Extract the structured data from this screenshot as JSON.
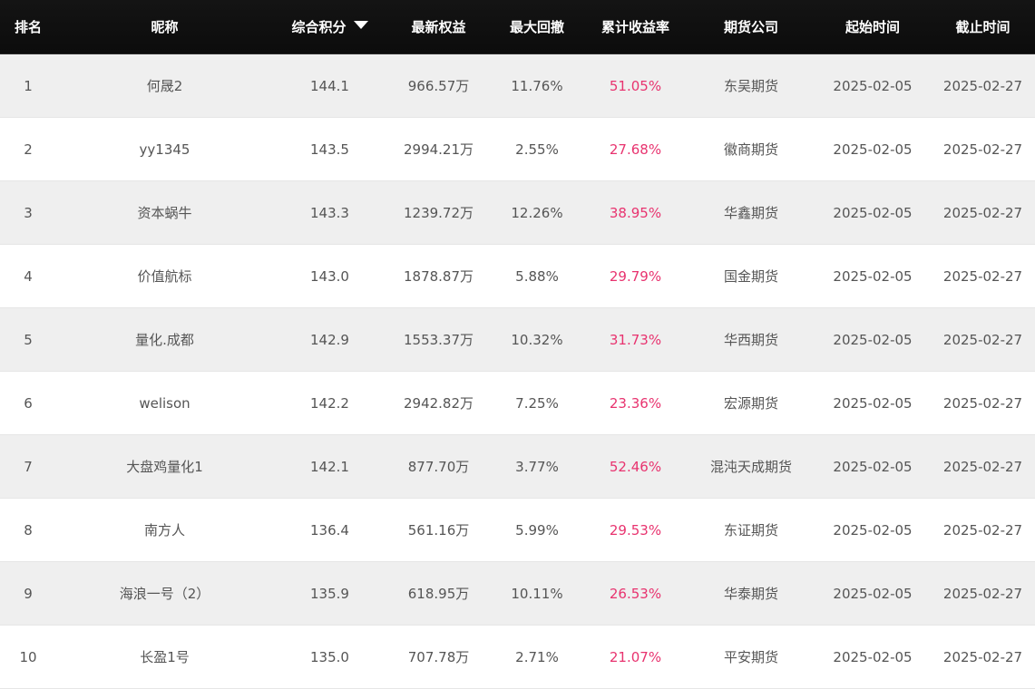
{
  "table": {
    "headers": {
      "rank": "排名",
      "nickname": "昵称",
      "score": "综合积分",
      "equity": "最新权益",
      "drawdown": "最大回撤",
      "return": "累计收益率",
      "company": "期货公司",
      "start": "起始时间",
      "end": "截止时间"
    },
    "sort_icon": "caret-down-icon",
    "return_color": "#e8336f",
    "rows": [
      {
        "rank": "1",
        "nickname": "何晟2",
        "score": "144.1",
        "equity": "966.57万",
        "drawdown": "11.76%",
        "return": "51.05%",
        "company": "东吴期货",
        "start": "2025-02-05",
        "end": "2025-02-27"
      },
      {
        "rank": "2",
        "nickname": "yy1345",
        "score": "143.5",
        "equity": "2994.21万",
        "drawdown": "2.55%",
        "return": "27.68%",
        "company": "徽商期货",
        "start": "2025-02-05",
        "end": "2025-02-27"
      },
      {
        "rank": "3",
        "nickname": "资本蜗牛",
        "score": "143.3",
        "equity": "1239.72万",
        "drawdown": "12.26%",
        "return": "38.95%",
        "company": "华鑫期货",
        "start": "2025-02-05",
        "end": "2025-02-27"
      },
      {
        "rank": "4",
        "nickname": "价值航标",
        "score": "143.0",
        "equity": "1878.87万",
        "drawdown": "5.88%",
        "return": "29.79%",
        "company": "国金期货",
        "start": "2025-02-05",
        "end": "2025-02-27"
      },
      {
        "rank": "5",
        "nickname": "量化.成都",
        "score": "142.9",
        "equity": "1553.37万",
        "drawdown": "10.32%",
        "return": "31.73%",
        "company": "华西期货",
        "start": "2025-02-05",
        "end": "2025-02-27"
      },
      {
        "rank": "6",
        "nickname": "welison",
        "score": "142.2",
        "equity": "2942.82万",
        "drawdown": "7.25%",
        "return": "23.36%",
        "company": "宏源期货",
        "start": "2025-02-05",
        "end": "2025-02-27"
      },
      {
        "rank": "7",
        "nickname": "大盘鸡量化1",
        "score": "142.1",
        "equity": "877.70万",
        "drawdown": "3.77%",
        "return": "52.46%",
        "company": "混沌天成期货",
        "start": "2025-02-05",
        "end": "2025-02-27"
      },
      {
        "rank": "8",
        "nickname": "南方人",
        "score": "136.4",
        "equity": "561.16万",
        "drawdown": "5.99%",
        "return": "29.53%",
        "company": "东证期货",
        "start": "2025-02-05",
        "end": "2025-02-27"
      },
      {
        "rank": "9",
        "nickname": "海浪一号（2）",
        "score": "135.9",
        "equity": "618.95万",
        "drawdown": "10.11%",
        "return": "26.53%",
        "company": "华泰期货",
        "start": "2025-02-05",
        "end": "2025-02-27"
      },
      {
        "rank": "10",
        "nickname": "长盈1号",
        "score": "135.0",
        "equity": "707.78万",
        "drawdown": "2.71%",
        "return": "21.07%",
        "company": "平安期货",
        "start": "2025-02-05",
        "end": "2025-02-27"
      }
    ]
  }
}
